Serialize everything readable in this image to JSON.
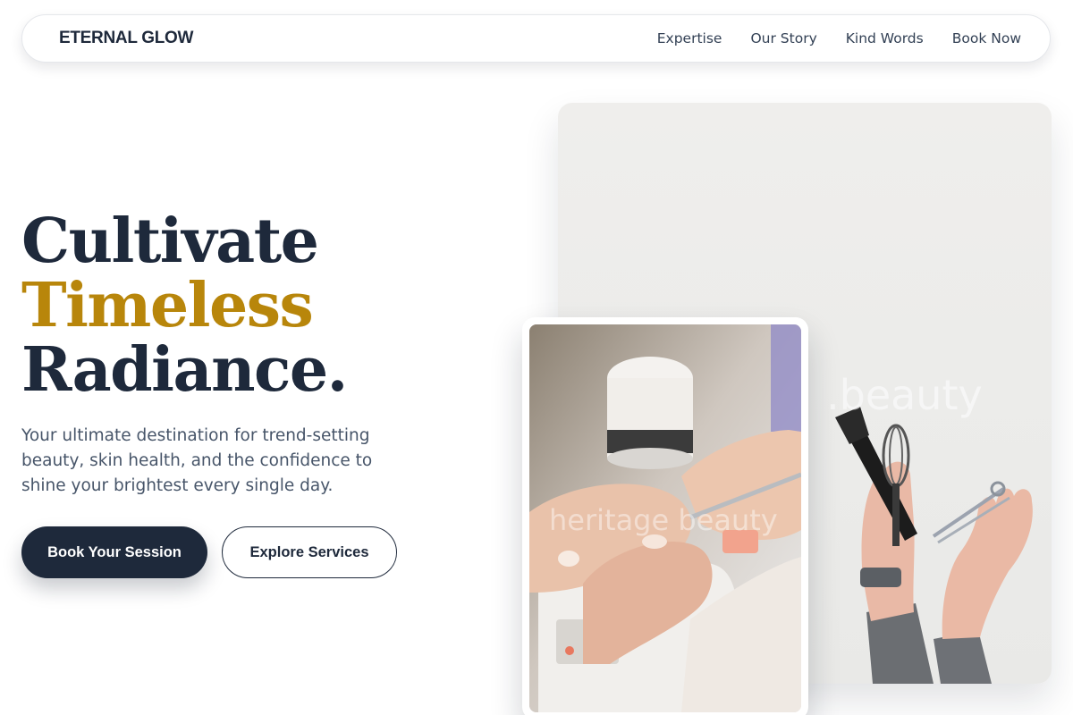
{
  "brand": "ETERNAL GLOW",
  "nav": {
    "links": [
      "Expertise",
      "Our Story",
      "Kind Words",
      "Book Now"
    ]
  },
  "hero": {
    "line1": "Cultivate",
    "line2": "Timeless",
    "line3": "Radiance.",
    "subtext": "Your ultimate destination for trend-setting beauty, skin health, and the confidence to shine your brightest every single day.",
    "primary_cta": "Book Your Session",
    "secondary_cta": "Explore Services"
  },
  "images": {
    "main_watermark": ".beauty",
    "secondary_watermark": "heritage beauty"
  },
  "colors": {
    "navy": "#1e293b",
    "gold": "#b8860b",
    "body_text": "#475569"
  }
}
